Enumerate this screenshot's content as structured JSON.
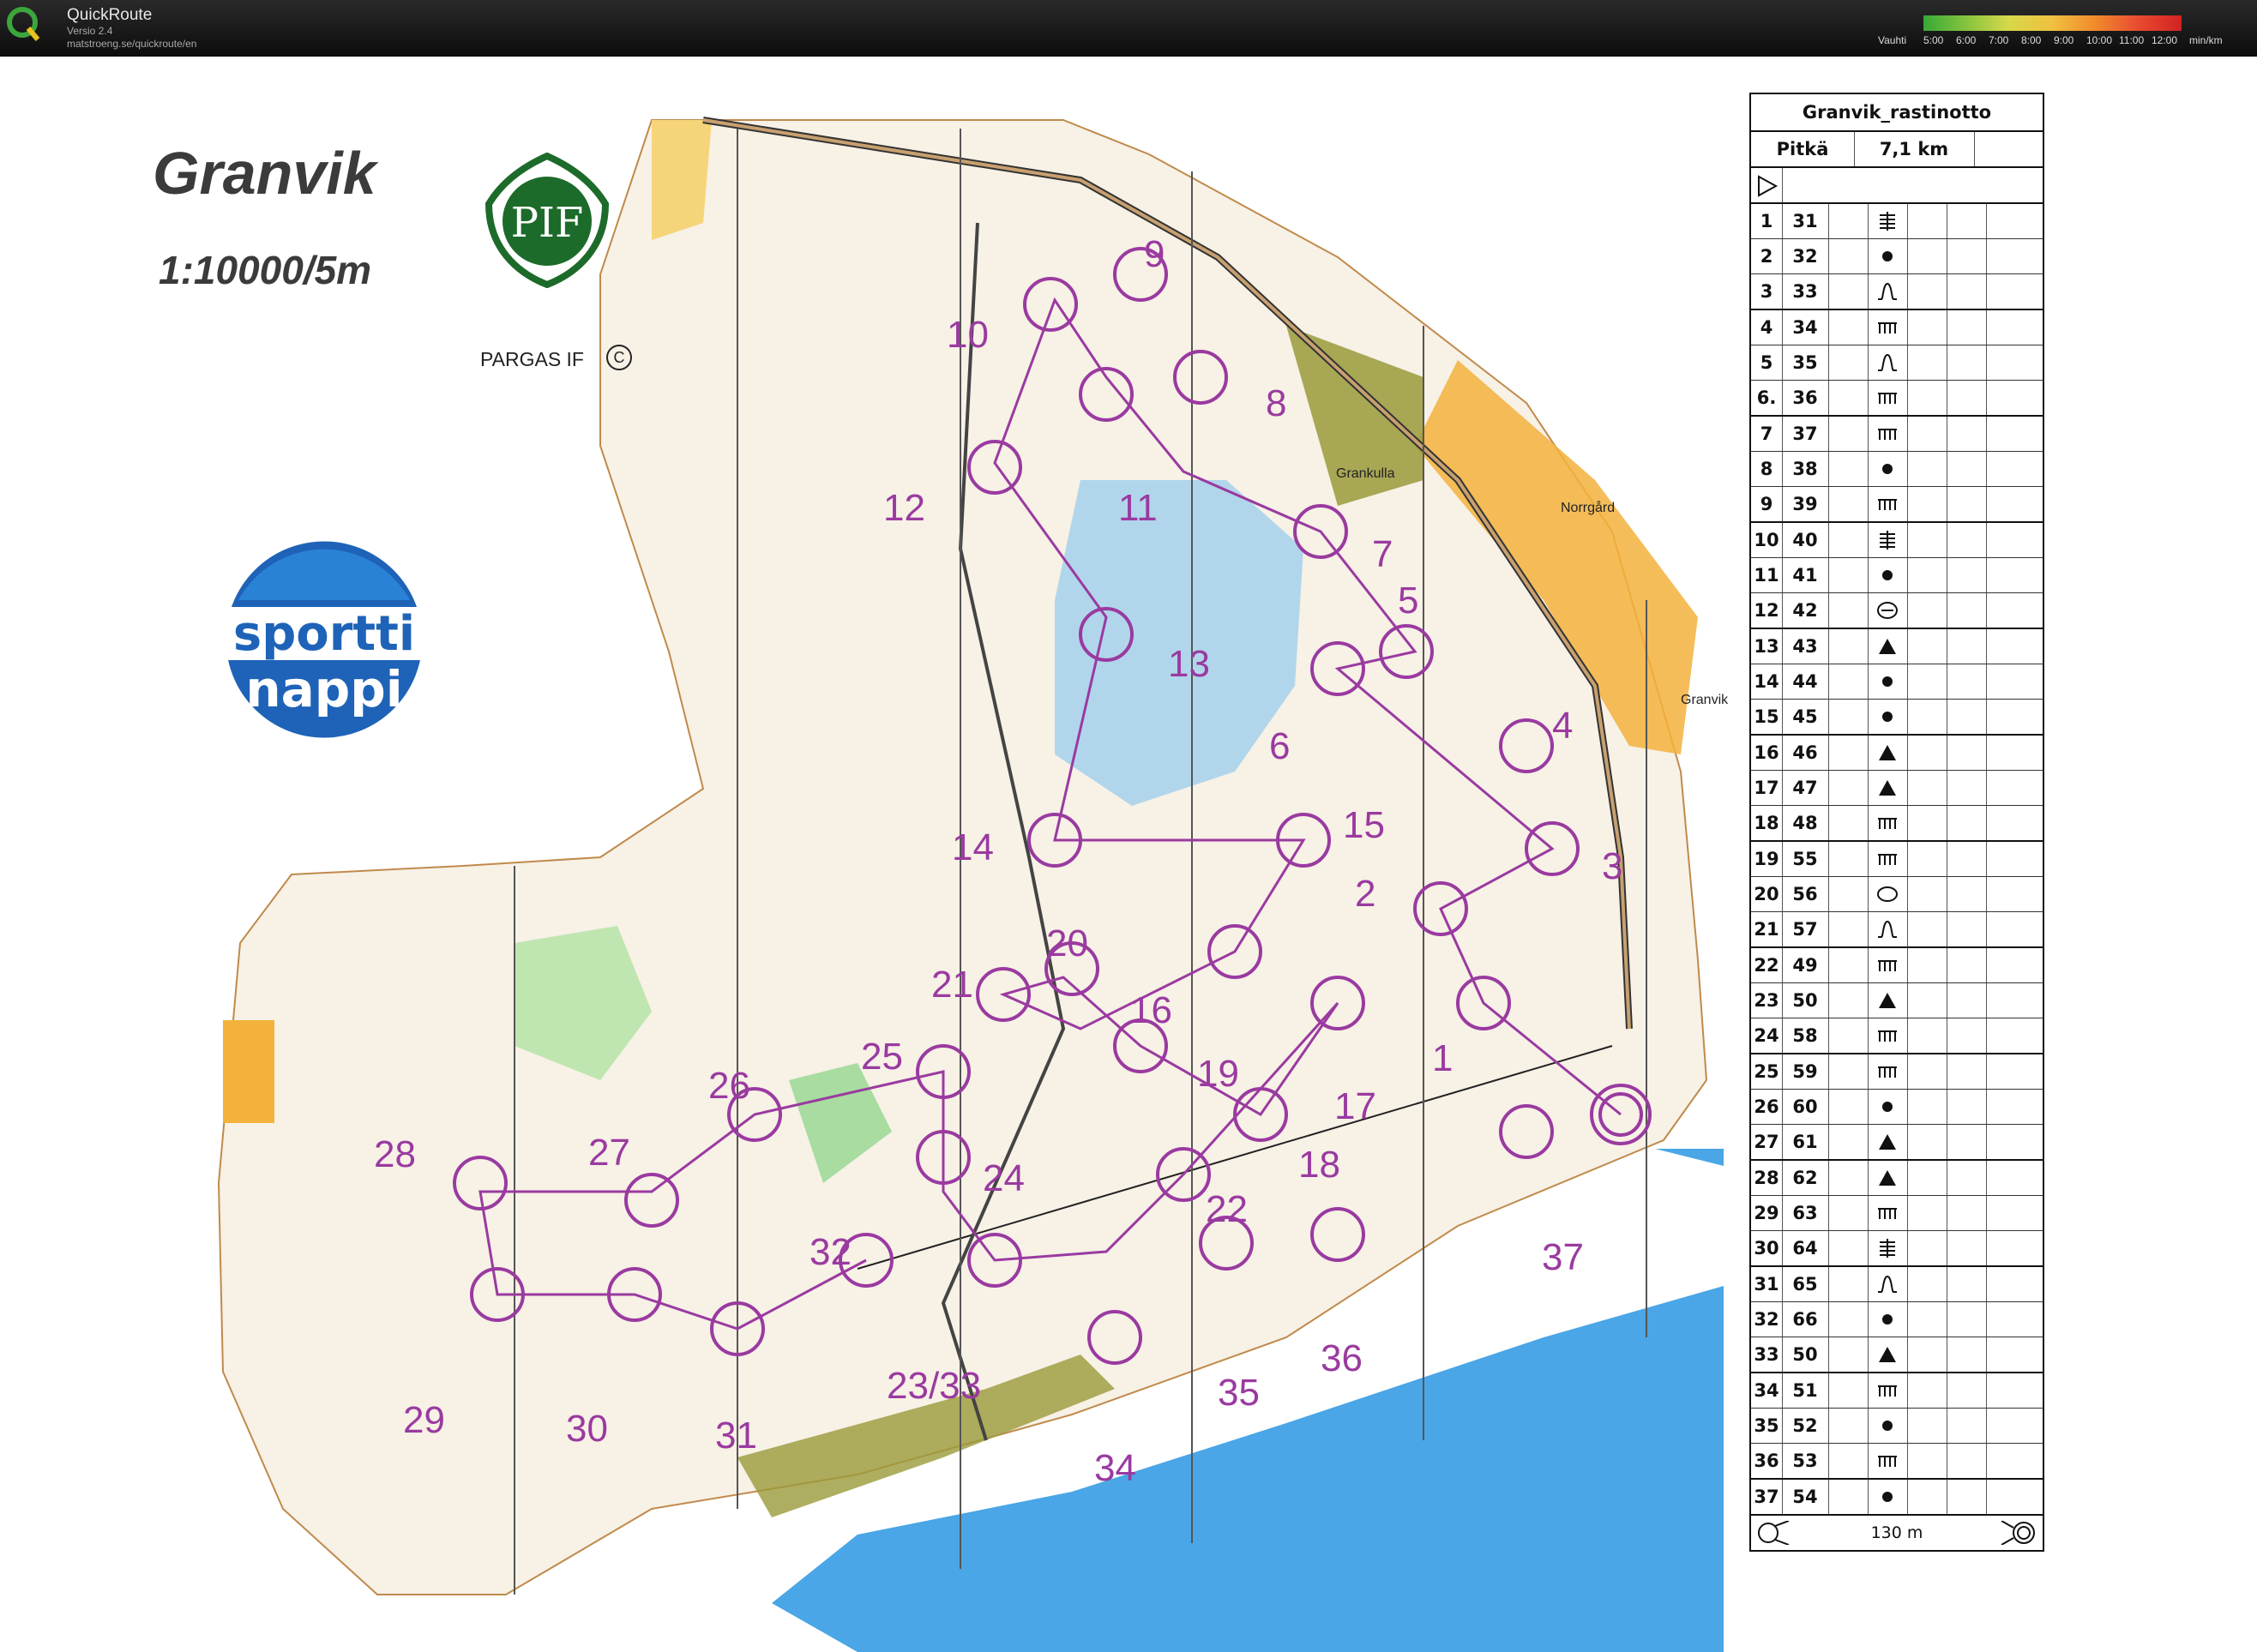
{
  "app": {
    "name": "QuickRoute",
    "version": "Versio 2.4",
    "url": "matstroeng.se/quickroute/en",
    "pace_label": "Vauhti",
    "pace_ticks": [
      "5:00",
      "6:00",
      "7:00",
      "8:00",
      "9:00",
      "10:00",
      "11:00",
      "12:00",
      "min/km"
    ]
  },
  "map": {
    "title": "Granvik",
    "scale": "1:10000/5m",
    "club_logo_text": "PIF",
    "club_name": "PARGAS IF",
    "copyright_symbol": "C",
    "sponsor_logo_line1": "sportti",
    "sponsor_logo_line2": "nappi",
    "place_names": [
      "Grankulla",
      "Norrgård",
      "Granvik"
    ],
    "controls": [
      {
        "label": "1"
      },
      {
        "label": "2"
      },
      {
        "label": "3"
      },
      {
        "label": "4"
      },
      {
        "label": "5"
      },
      {
        "label": "6"
      },
      {
        "label": "7"
      },
      {
        "label": "8"
      },
      {
        "label": "9"
      },
      {
        "label": "10"
      },
      {
        "label": "11"
      },
      {
        "label": "12"
      },
      {
        "label": "13"
      },
      {
        "label": "14"
      },
      {
        "label": "15"
      },
      {
        "label": "16"
      },
      {
        "label": "17"
      },
      {
        "label": "18"
      },
      {
        "label": "19"
      },
      {
        "label": "20"
      },
      {
        "label": "21"
      },
      {
        "label": "22"
      },
      {
        "label": "23/33"
      },
      {
        "label": "24"
      },
      {
        "label": "25"
      },
      {
        "label": "26"
      },
      {
        "label": "27"
      },
      {
        "label": "28"
      },
      {
        "label": "29"
      },
      {
        "label": "30"
      },
      {
        "label": "31"
      },
      {
        "label": "32"
      },
      {
        "label": "34"
      },
      {
        "label": "35"
      },
      {
        "label": "36"
      },
      {
        "label": "37"
      }
    ]
  },
  "description": {
    "title": "Granvik_rastinotto",
    "class": "Pitkä",
    "length": "7,1 km",
    "rows": [
      {
        "n": "1",
        "code": "31",
        "sym": "stream"
      },
      {
        "n": "2",
        "code": "32",
        "sym": "dot"
      },
      {
        "n": "3",
        "code": "33",
        "sym": "bell"
      },
      {
        "n": "4",
        "code": "34",
        "sym": "comb"
      },
      {
        "n": "5",
        "code": "35",
        "sym": "bell"
      },
      {
        "n": "6.",
        "code": "36",
        "sym": "comb"
      },
      {
        "n": "7",
        "code": "37",
        "sym": "comb"
      },
      {
        "n": "8",
        "code": "38",
        "sym": "dot"
      },
      {
        "n": "9",
        "code": "39",
        "sym": "comb"
      },
      {
        "n": "10",
        "code": "40",
        "sym": "stream"
      },
      {
        "n": "11",
        "code": "41",
        "sym": "dot"
      },
      {
        "n": "12",
        "code": "42",
        "sym": "ring-cross"
      },
      {
        "n": "13",
        "code": "43",
        "sym": "triangle"
      },
      {
        "n": "14",
        "code": "44",
        "sym": "dot"
      },
      {
        "n": "15",
        "code": "45",
        "sym": "dot"
      },
      {
        "n": "16",
        "code": "46",
        "sym": "triangle"
      },
      {
        "n": "17",
        "code": "47",
        "sym": "triangle"
      },
      {
        "n": "18",
        "code": "48",
        "sym": "comb"
      },
      {
        "n": "19",
        "code": "55",
        "sym": "comb"
      },
      {
        "n": "20",
        "code": "56",
        "sym": "oval"
      },
      {
        "n": "21",
        "code": "57",
        "sym": "bell"
      },
      {
        "n": "22",
        "code": "49",
        "sym": "comb"
      },
      {
        "n": "23",
        "code": "50",
        "sym": "triangle"
      },
      {
        "n": "24",
        "code": "58",
        "sym": "comb"
      },
      {
        "n": "25",
        "code": "59",
        "sym": "comb"
      },
      {
        "n": "26",
        "code": "60",
        "sym": "dot"
      },
      {
        "n": "27",
        "code": "61",
        "sym": "triangle"
      },
      {
        "n": "28",
        "code": "62",
        "sym": "triangle"
      },
      {
        "n": "29",
        "code": "63",
        "sym": "comb"
      },
      {
        "n": "30",
        "code": "64",
        "sym": "stream"
      },
      {
        "n": "31",
        "code": "65",
        "sym": "bell"
      },
      {
        "n": "32",
        "code": "66",
        "sym": "dot"
      },
      {
        "n": "33",
        "code": "50",
        "sym": "triangle"
      },
      {
        "n": "34",
        "code": "51",
        "sym": "comb"
      },
      {
        "n": "35",
        "code": "52",
        "sym": "dot"
      },
      {
        "n": "36",
        "code": "53",
        "sym": "comb"
      },
      {
        "n": "37",
        "code": "54",
        "sym": "dot"
      }
    ],
    "finish_distance": "130 m"
  }
}
